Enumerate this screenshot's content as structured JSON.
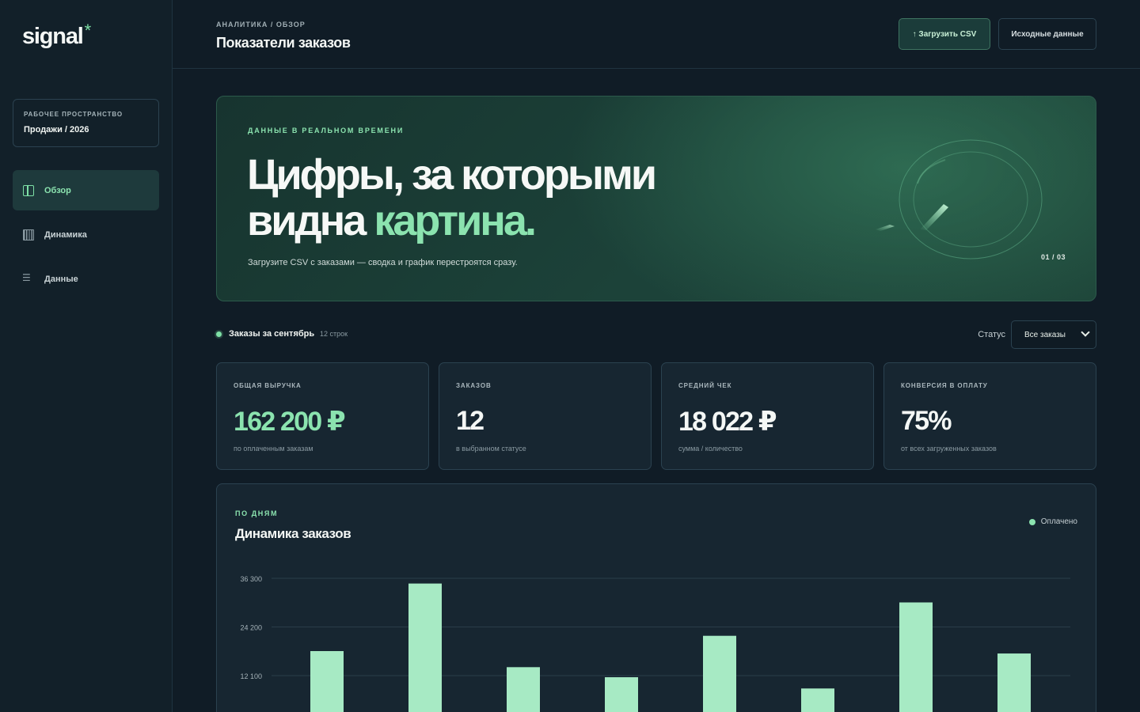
{
  "sidebar": {
    "logo": "signal",
    "logo_mark": "*",
    "workspace_label": "Рабочее пространство",
    "workspace_name": "Продажи / 2026",
    "items": [
      {
        "label": "Обзор",
        "icon": "layout-columns-icon",
        "active": true
      },
      {
        "label": "Динамика",
        "icon": "bars-icon",
        "active": false
      },
      {
        "label": "Данные",
        "icon": "list-icon",
        "active": false
      }
    ]
  },
  "header": {
    "breadcrumb": "Аналитика / Обзор",
    "title": "Показатели заказов",
    "upload_label": "↑ Загрузить CSV",
    "raw_label": "Исходные данные"
  },
  "hero": {
    "eyebrow": "Данные в реальном времени",
    "title_line1": "Цифры, за которыми",
    "title_line2_plain": "видна ",
    "title_line2_accent": "картина.",
    "subtitle": "Загрузите CSV с заказами — сводка и график перестроятся сразу.",
    "counter": "01 / 03"
  },
  "section": {
    "title": "Заказы за сентябрь",
    "count": "12 строк",
    "status_label": "Статус",
    "status_value": "Все заказы"
  },
  "kpis": [
    {
      "label": "Общая выручка",
      "value": "162 200 ₽",
      "note": "по оплаченным заказам"
    },
    {
      "label": "Заказов",
      "value": "12",
      "note": "в выбранном статусе"
    },
    {
      "label": "Средний чек",
      "value": "18 022 ₽",
      "note": "сумма / количество"
    },
    {
      "label": "Конверсия в оплату",
      "value": "75%",
      "note": "от всех загруженных заказов"
    }
  ],
  "chart": {
    "eyebrow": "По дням",
    "title": "Динамика заказов",
    "legend": "Оплачено"
  },
  "colors": {
    "accent": "#8be3af",
    "bar": "#a7eac4",
    "grid": "#2a3d49"
  },
  "chart_data": {
    "type": "bar",
    "series": [
      {
        "name": "Оплачено",
        "values": [
          18200,
          35000,
          14200,
          11700,
          22000,
          8900,
          30300,
          17600
        ]
      }
    ],
    "yticks": [
      12100,
      24200,
      36300
    ],
    "ytick_labels": [
      "12 100",
      "24 200",
      "36 300"
    ],
    "ylim": [
      0,
      36300
    ],
    "grid": true,
    "legend_position": "top-right"
  }
}
